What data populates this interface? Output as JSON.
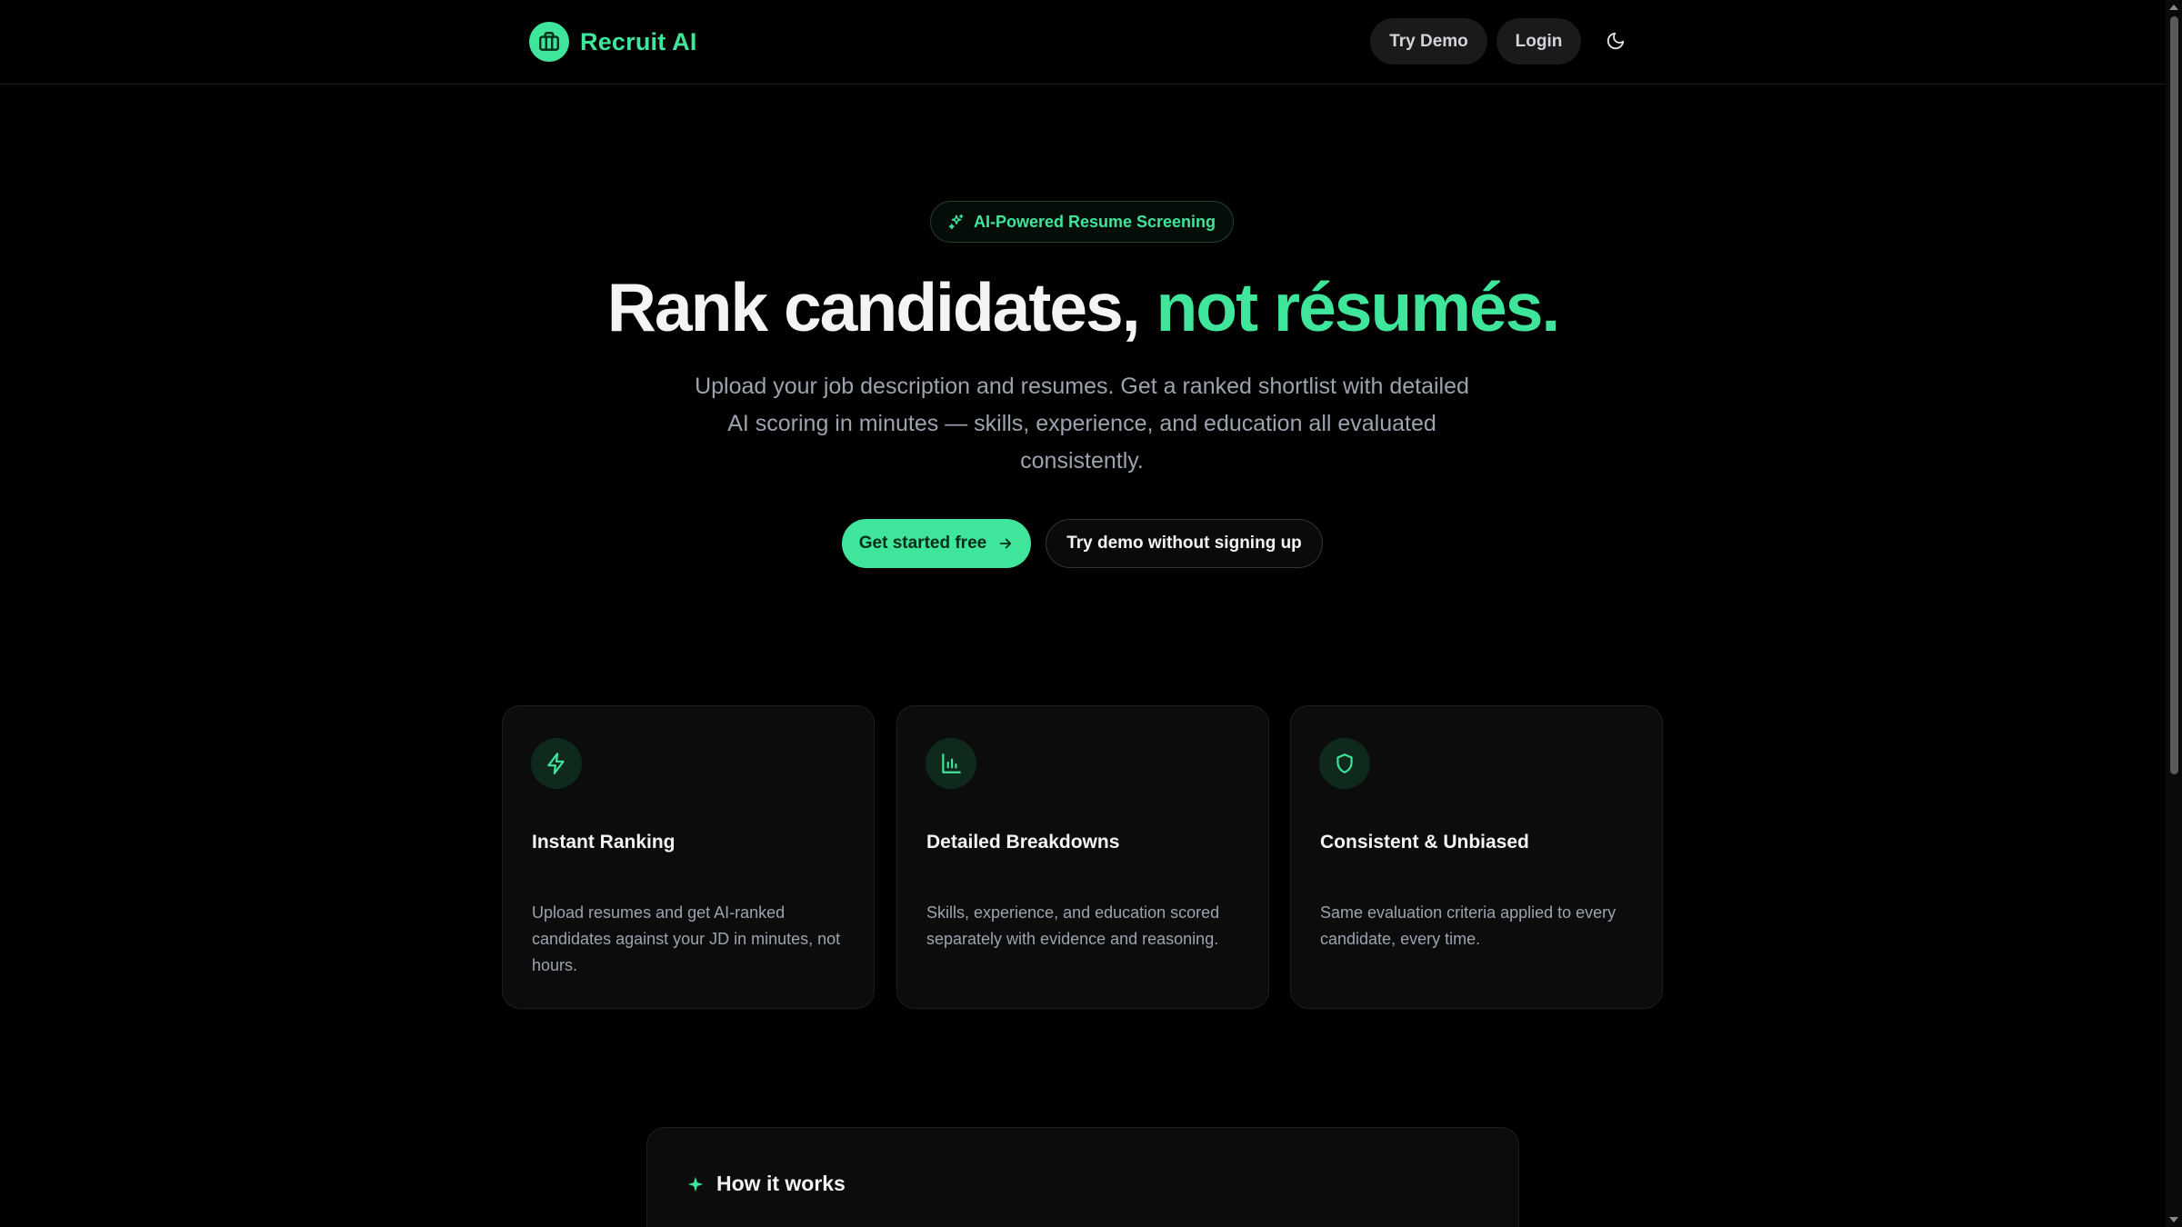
{
  "header": {
    "brand_name": "Recruit AI",
    "logo_icon": "briefcase-icon",
    "try_demo_label": "Try Demo",
    "login_label": "Login",
    "theme_icon": "moon-icon"
  },
  "hero": {
    "badge_icon": "sparkles-icon",
    "badge_text": "AI-Powered Resume Screening",
    "headline_white": "Rank candidates,",
    "headline_green": "not résumés.",
    "subtitle": "Upload your job description and resumes. Get a ranked shortlist with detailed AI scoring in minutes — skills, experience, and education all evaluated consistently.",
    "primary_cta": "Get started free",
    "primary_cta_icon": "arrow-right-icon",
    "secondary_cta": "Try demo without signing up"
  },
  "features": [
    {
      "icon": "zap-icon",
      "title": "Instant Ranking",
      "description": "Upload resumes and get AI-ranked candidates against your JD in minutes, not hours."
    },
    {
      "icon": "bar-chart-icon",
      "title": "Detailed Breakdowns",
      "description": "Skills, experience, and education scored separately with evidence and reasoning."
    },
    {
      "icon": "shield-icon",
      "title": "Consistent & Unbiased",
      "description": "Same evaluation criteria applied to every candidate, every time."
    }
  ],
  "how_it_works": {
    "icon": "sparkle-icon",
    "title": "How it works"
  },
  "colors": {
    "background": "#000000",
    "accent": "#3ee59a",
    "card": "#0c0c0d",
    "muted_text": "#9ca3af"
  }
}
